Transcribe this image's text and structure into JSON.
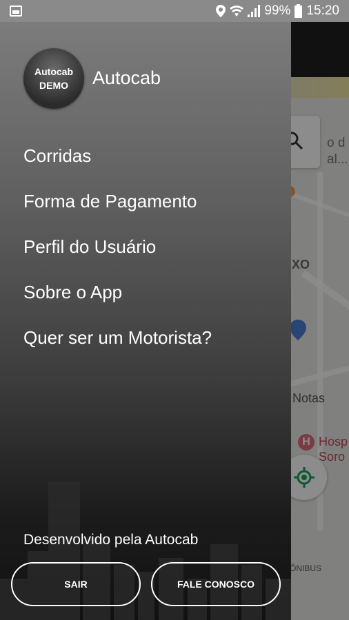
{
  "status_bar": {
    "battery": "99%",
    "time": "15:20",
    "icons": [
      "image-icon",
      "location-icon",
      "wifi-icon",
      "signal-icon",
      "battery-icon"
    ]
  },
  "map": {
    "search_hint": "o d al...",
    "labels": {
      "area": "IXO",
      "notas": "Notas",
      "hospital": "Hosp Soro",
      "onibus": "ÔNIBUS"
    }
  },
  "drawer": {
    "avatar_line1": "Autocab",
    "avatar_line2": "DEMO",
    "app_name": "Autocab",
    "menu": [
      {
        "label": "Corridas"
      },
      {
        "label": "Forma de Pagamento"
      },
      {
        "label": "Perfil do Usuário"
      },
      {
        "label": "Sobre o App"
      },
      {
        "label": "Quer ser um Motorista?"
      }
    ],
    "developer_text": "Desenvolvido pela Autocab",
    "buttons": {
      "logout": "SAIR",
      "contact": "FALE CONOSCO"
    }
  },
  "colors": {
    "drawer_top": "#7c7c7c",
    "drawer_bottom": "#111111",
    "accent_green": "#1aa05a",
    "hospital_red": "#e26a7a"
  }
}
